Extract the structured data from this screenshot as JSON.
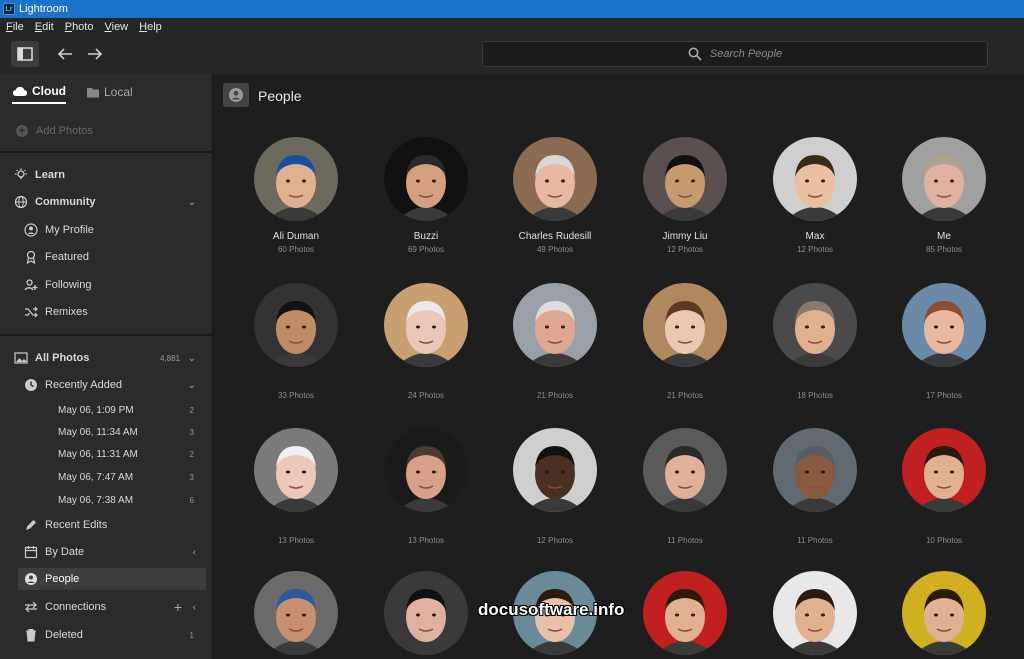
{
  "window": {
    "title": "Lightroom",
    "logo": "Lr"
  },
  "menu": [
    "File",
    "Edit",
    "Photo",
    "View",
    "Help"
  ],
  "search": {
    "placeholder": "Search People"
  },
  "sidebar": {
    "tabs": {
      "cloud": "Cloud",
      "local": "Local"
    },
    "add_photos": "Add Photos",
    "learn": "Learn",
    "community": "Community",
    "community_items": {
      "my_profile": "My Profile",
      "featured": "Featured",
      "following": "Following",
      "remixes": "Remixes"
    },
    "all_photos": {
      "label": "All Photos",
      "count": "4,881"
    },
    "recently_added": "Recently Added",
    "recent_dates": [
      {
        "label": "May 06, 1:09 PM",
        "count": "2"
      },
      {
        "label": "May 06, 11:34 AM",
        "count": "3"
      },
      {
        "label": "May 06, 11:31 AM",
        "count": "2"
      },
      {
        "label": "May 06, 7:47 AM",
        "count": "3"
      },
      {
        "label": "May 06, 7:38 AM",
        "count": "6"
      }
    ],
    "recent_edits": "Recent Edits",
    "by_date": "By Date",
    "people": "People",
    "connections": "Connections",
    "deleted": {
      "label": "Deleted",
      "count": "1"
    }
  },
  "main": {
    "title": "People",
    "people": [
      {
        "name": "Ali Duman",
        "count": "60 Photos",
        "bg": "#6c6a5e",
        "skin": "#e0b08f",
        "hair": "#1a4fa0"
      },
      {
        "name": "Buzzi",
        "count": "69 Photos",
        "bg": "#111111",
        "skin": "#d4a080",
        "hair": "#2a2a2a"
      },
      {
        "name": "Charles Rudesill",
        "count": "49 Photos",
        "bg": "#8a6a50",
        "skin": "#e8b8a0",
        "hair": "#d8d8d8"
      },
      {
        "name": "Jimmy Liu",
        "count": "12 Photos",
        "bg": "#5a5050",
        "skin": "#c89a70",
        "hair": "#111111"
      },
      {
        "name": "Max",
        "count": "12 Photos",
        "bg": "#cfcfcf",
        "skin": "#eac0a0",
        "hair": "#3a2a1a"
      },
      {
        "name": "Me",
        "count": "85 Photos",
        "bg": "#a0a0a0",
        "skin": "#e0b0a0",
        "hair": "#b0a090"
      },
      {
        "name": "",
        "count": "33 Photos",
        "bg": "#333333",
        "skin": "#c08c68",
        "hair": "#111111"
      },
      {
        "name": "",
        "count": "24 Photos",
        "bg": "#c8a070",
        "skin": "#eac8b8",
        "hair": "#e8e8e8"
      },
      {
        "name": "",
        "count": "21 Photos",
        "bg": "#9aa0a8",
        "skin": "#e0a890",
        "hair": "#dddddd"
      },
      {
        "name": "",
        "count": "21 Photos",
        "bg": "#b08860",
        "skin": "#ecc8b0",
        "hair": "#5a3a20"
      },
      {
        "name": "",
        "count": "18 Photos",
        "bg": "#4a4a4a",
        "skin": "#e0b090",
        "hair": "#8a7a6a"
      },
      {
        "name": "",
        "count": "17 Photos",
        "bg": "#6a8aa8",
        "skin": "#e8b8a0",
        "hair": "#8a5030"
      },
      {
        "name": "",
        "count": "13 Photos",
        "bg": "#7a7a7a",
        "skin": "#ecc8b8",
        "hair": "#f0f0f0"
      },
      {
        "name": "",
        "count": "13 Photos",
        "bg": "#1a1a1a",
        "skin": "#d8a088",
        "hair": "#4a3a30"
      },
      {
        "name": "",
        "count": "12 Photos",
        "bg": "#cfcfcf",
        "skin": "#4a3020",
        "hair": "#111111"
      },
      {
        "name": "",
        "count": "11 Photos",
        "bg": "#5a5a5a",
        "skin": "#e0b098",
        "hair": "#2a2a2a"
      },
      {
        "name": "",
        "count": "11 Photos",
        "bg": "#606a70",
        "skin": "#8a5a40",
        "hair": "#555c66"
      },
      {
        "name": "",
        "count": "10 Photos",
        "bg": "#c02020",
        "skin": "#e0b090",
        "hair": "#2a1a10"
      },
      {
        "name": "",
        "count": "",
        "bg": "#6a6a6a",
        "skin": "#c89070",
        "hair": "#2a5aa0"
      },
      {
        "name": "",
        "count": "",
        "bg": "#3a3a3a",
        "skin": "#e0b0a0",
        "hair": "#111111"
      },
      {
        "name": "",
        "count": "",
        "bg": "#6a8a9a",
        "skin": "#eac0a8",
        "hair": "#2a1a10"
      },
      {
        "name": "",
        "count": "",
        "bg": "#c02020",
        "skin": "#e0b090",
        "hair": "#2a1a10"
      },
      {
        "name": "",
        "count": "",
        "bg": "#e8e8e8",
        "skin": "#e0b090",
        "hair": "#2a1a10"
      },
      {
        "name": "",
        "count": "",
        "bg": "#d0b020",
        "skin": "#e0b090",
        "hair": "#2a1a10"
      }
    ]
  },
  "watermark": "docusoftware.info"
}
